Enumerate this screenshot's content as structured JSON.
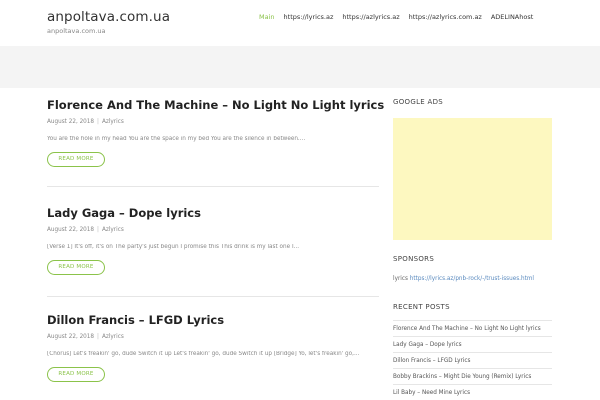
{
  "site": {
    "title": "anpoltava.com.ua",
    "description": "anpoltava.com.ua"
  },
  "nav": [
    {
      "label": "Main",
      "active": true
    },
    {
      "label": "https://lyrics.az",
      "active": false
    },
    {
      "label": "https://azlyrics.az",
      "active": false
    },
    {
      "label": "https://azlyrics.com.az",
      "active": false
    },
    {
      "label": "ADELINAhost",
      "active": false
    }
  ],
  "posts": [
    {
      "title": "Florence And The Machine – No Light No Light lyrics",
      "date": "August 22, 2018",
      "author": "Azlyrics",
      "excerpt": "You are the hole in my head You are the space in my bed You are the silence in between....",
      "read_more": "READ MORE"
    },
    {
      "title": "Lady Gaga – Dope lyrics",
      "date": "August 22, 2018",
      "author": "Azlyrics",
      "excerpt": "[Verse 1] It's off, it's on The party's just begun I promise this This drink is my last one I...",
      "read_more": "READ MORE"
    },
    {
      "title": "Dillon Francis – LFGD Lyrics",
      "date": "August 22, 2018",
      "author": "Azlyrics",
      "excerpt": "[Chorus] Let's freakin' go, dude Switch it up Let's freakin' go, dude Switch it up [Bridge] Yo, let's freakin' go,...",
      "read_more": "READ MORE"
    }
  ],
  "sidebar": {
    "ads_title": "GOOGLE ADS",
    "ad_color": "#fdf8c0",
    "sponsors_title": "SPONSORS",
    "sponsor_prefix": "lyrics",
    "sponsor_link": "https://lyrics.az/pnb-rock/-/trust-issues.html",
    "recent_title": "RECENT POSTS",
    "recent": [
      "Florence And The Machine – No Light No Light lyrics",
      "Lady Gaga – Dope lyrics",
      "Dillon Francis – LFGD Lyrics",
      "Bobby Brackins – Might Die Young (Remix) Lyrics",
      "Lil Baby – Need Mine Lyrics"
    ]
  },
  "colors": {
    "accent": "#8bc34a",
    "link": "#5a8abf"
  }
}
